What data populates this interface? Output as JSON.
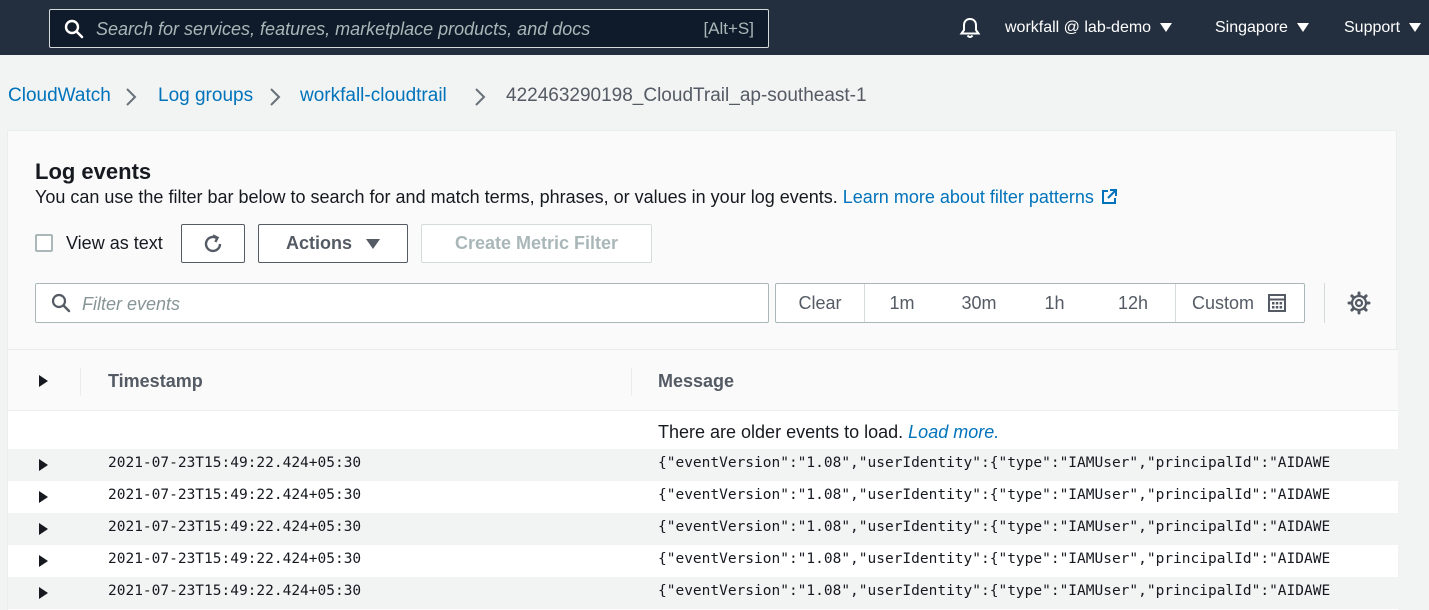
{
  "topnav": {
    "search_placeholder": "Search for services, features, marketplace products, and docs",
    "search_shortcut": "[Alt+S]",
    "account": "workfall @ lab-demo",
    "region": "Singapore",
    "support": "Support",
    "bell_icon": "bell-icon"
  },
  "breadcrumb": {
    "items": [
      "CloudWatch",
      "Log groups",
      "workfall-cloudtrail"
    ],
    "current": "422463290198_CloudTrail_ap-southeast-1"
  },
  "log_events": {
    "title": "Log events",
    "description": "You can use the filter bar below to search for and match terms, phrases, or values in your log events.",
    "learn_more": "Learn more about filter patterns",
    "view_as_text": "View as text",
    "view_as_text_checked": false,
    "actions": "Actions",
    "create_metric_filter": "Create Metric Filter",
    "filter_placeholder": "Filter events",
    "time_range": [
      "Clear",
      "1m",
      "30m",
      "1h",
      "12h",
      "Custom"
    ]
  },
  "table": {
    "columns": [
      "Timestamp",
      "Message"
    ],
    "older_events": "There are older events to load.",
    "load_more": "Load more.",
    "rows": [
      {
        "timestamp": "2021-07-23T15:49:22.424+05:30",
        "message": "{\"eventVersion\":\"1.08\",\"userIdentity\":{\"type\":\"IAMUser\",\"principalId\":\"AIDAWE"
      },
      {
        "timestamp": "2021-07-23T15:49:22.424+05:30",
        "message": "{\"eventVersion\":\"1.08\",\"userIdentity\":{\"type\":\"IAMUser\",\"principalId\":\"AIDAWE"
      },
      {
        "timestamp": "2021-07-23T15:49:22.424+05:30",
        "message": "{\"eventVersion\":\"1.08\",\"userIdentity\":{\"type\":\"IAMUser\",\"principalId\":\"AIDAWE"
      },
      {
        "timestamp": "2021-07-23T15:49:22.424+05:30",
        "message": "{\"eventVersion\":\"1.08\",\"userIdentity\":{\"type\":\"IAMUser\",\"principalId\":\"AIDAWE"
      },
      {
        "timestamp": "2021-07-23T15:49:22.424+05:30",
        "message": "{\"eventVersion\":\"1.08\",\"userIdentity\":{\"type\":\"IAMUser\",\"principalId\":\"AIDAWE"
      }
    ]
  },
  "colors": {
    "nav_bg": "#232f3e",
    "link": "#0073bb",
    "text": "#16191f",
    "muted": "#545b64"
  }
}
